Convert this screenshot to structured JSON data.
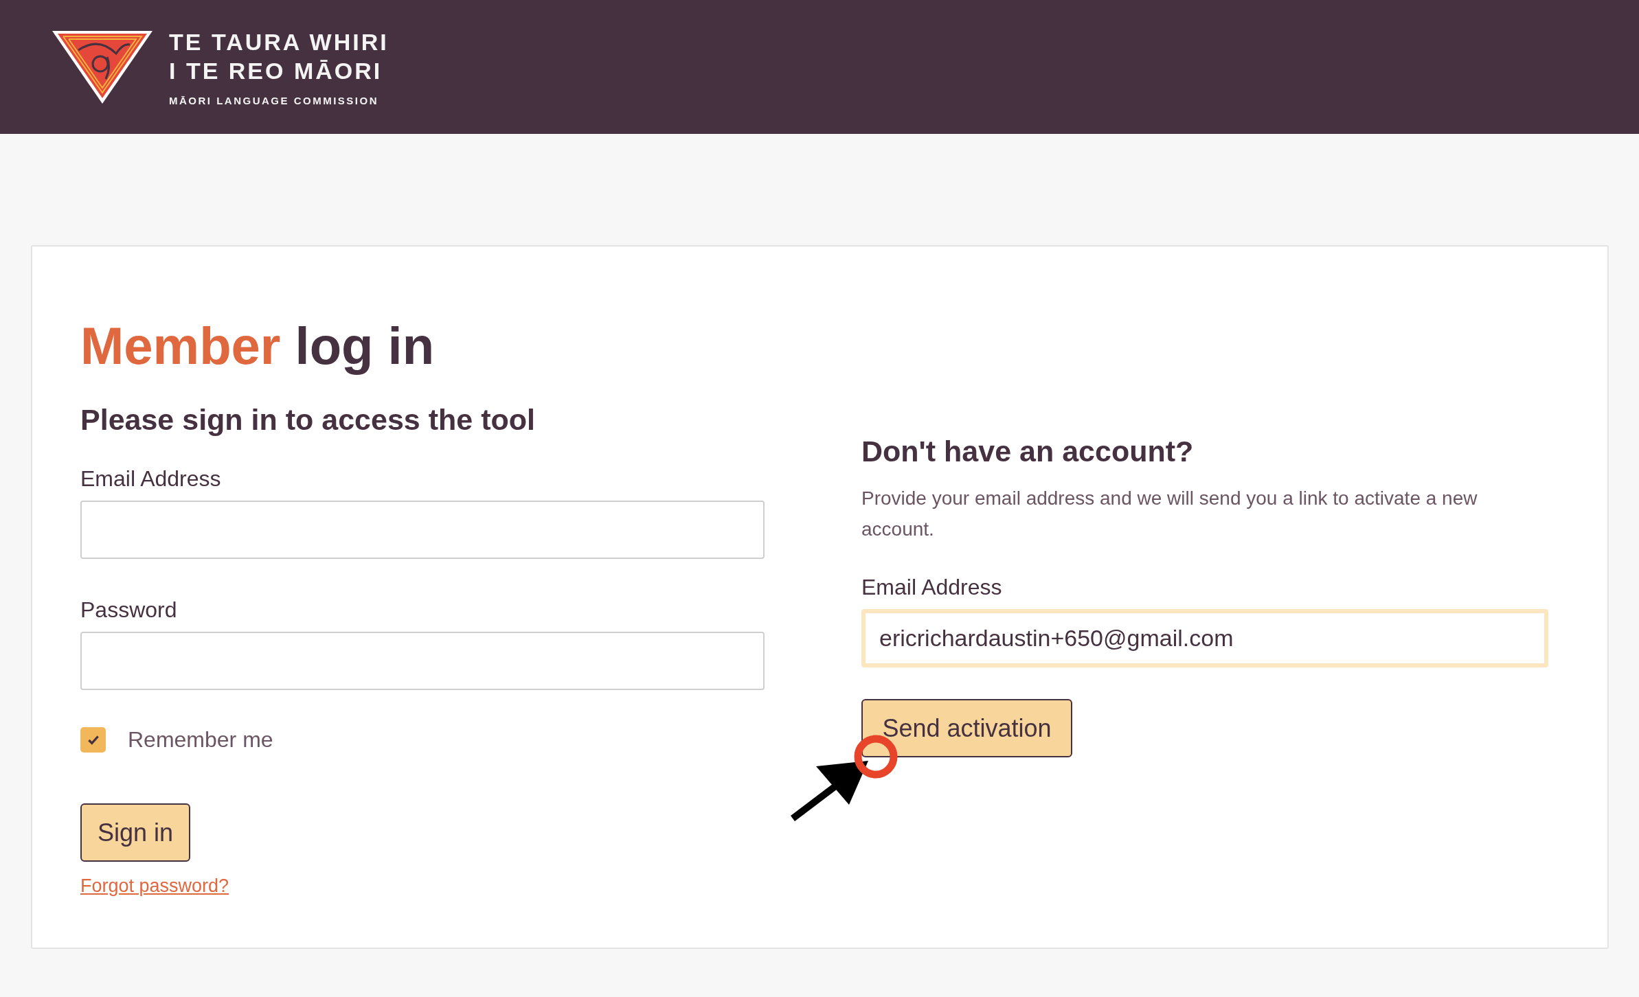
{
  "header": {
    "logo_title_lines": [
      "TE TAURA WHIRI",
      "I TE REO MĀORI"
    ],
    "logo_subtitle": "MĀORI LANGUAGE COMMISSION"
  },
  "login": {
    "title_highlight": "Member",
    "title_rest": "log in",
    "subtitle": "Please sign in to access the tool",
    "fields": [
      {
        "label": "Email Address"
      },
      {
        "label": "Password"
      }
    ],
    "remember": {
      "label": "Remember me",
      "checked": true
    },
    "submit": "Sign in",
    "forgot_link": "Forgot password?"
  },
  "signup": {
    "title": "Don't have an account?",
    "description": "Provide your email address and we will send you a link to activate a new account.",
    "field": {
      "label": "Email Address",
      "value": "ericrichardaustin+650@gmail.com",
      "focused": true
    },
    "submit": "Send activation"
  }
}
